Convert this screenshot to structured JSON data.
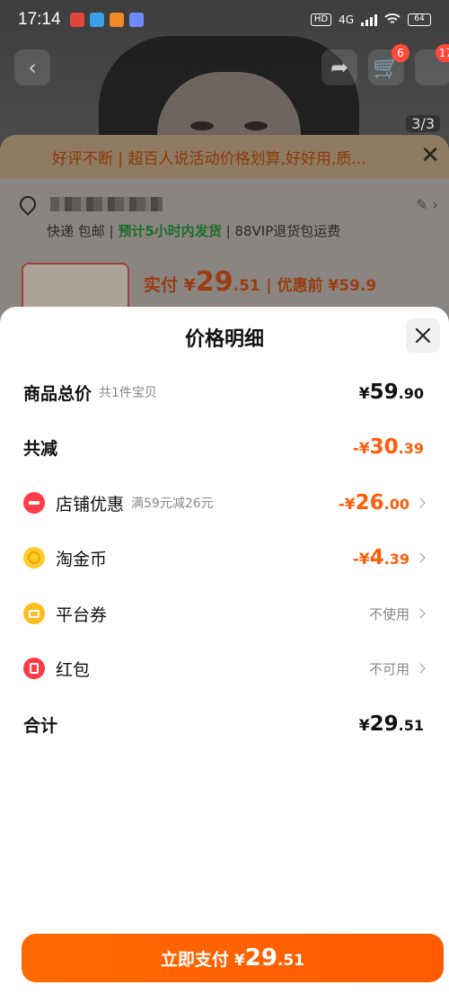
{
  "status_bar": {
    "time": "17:14",
    "hd": "HD",
    "network": "4G",
    "battery": "64"
  },
  "background": {
    "cart_badge": "6",
    "more_badge": "17",
    "image_counter": "3/3",
    "review_banner": "好评不断 | 超百人说活动价格划算,好好用,质...",
    "shipping_method": "快递 包邮",
    "shipping_time": "预计5小时内发货",
    "return_policy": "88VIP退货包运费",
    "pay_label": "实付",
    "pay_currency": "¥",
    "pay_int": "29",
    "pay_dec": ".51",
    "original_label": "| 优惠前 ¥59.9"
  },
  "sheet": {
    "title": "价格明细",
    "rows": [
      {
        "label": "商品总价",
        "sub": "共1件宝贝",
        "currency": "¥",
        "int": "59",
        "dec": ".90"
      },
      {
        "label": "共减",
        "currency": "-¥",
        "int": "30",
        "dec": ".39"
      },
      {
        "label": "店铺优惠",
        "sub": "满59元减26元",
        "currency": "-¥",
        "int": "26",
        "dec": ".00",
        "icon": "shop-coupon-icon"
      },
      {
        "label": "淘金币",
        "currency": "-¥",
        "int": "4",
        "dec": ".39",
        "icon": "gold-coin-icon"
      },
      {
        "label": "平台券",
        "status": "不使用",
        "icon": "platform-voucher-icon"
      },
      {
        "label": "红包",
        "status": "不可用",
        "icon": "red-packet-icon"
      },
      {
        "label": "合计",
        "currency": "¥",
        "int": "29",
        "dec": ".51"
      }
    ],
    "pay_button": {
      "label": "立即支付",
      "currency": "¥",
      "int": "29",
      "dec": ".51"
    }
  },
  "colors": {
    "accent": "#ff5d0a",
    "button": "#ff6a00",
    "icon_red": "#ff3b48",
    "icon_yellow": "#ffcd2e"
  }
}
